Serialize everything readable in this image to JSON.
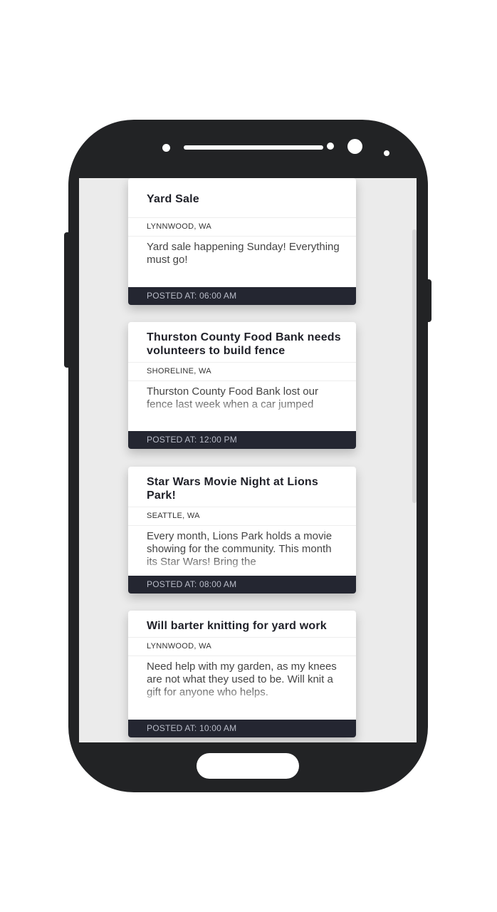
{
  "posts": [
    {
      "title": "Yard Sale",
      "location": "LYNNWOOD, WA",
      "body": "Yard sale happening Sunday! Everything must go!",
      "posted": "POSTED AT: 06:00 AM"
    },
    {
      "title": "Thurston County Food Bank needs volunteers to build fence",
      "location": "SHORELINE, WA",
      "body": "Thurston County Food Bank lost our fence last week when a car jumped",
      "posted": "POSTED AT: 12:00 PM"
    },
    {
      "title": "Star Wars Movie Night at Lions Park!",
      "location": "SEATTLE, WA",
      "body": "Every month, Lions Park holds a movie showing for the community. This month its Star Wars! Bring the",
      "posted": "POSTED AT: 08:00 AM"
    },
    {
      "title": "Will barter knitting for yard work",
      "location": "LYNNWOOD, WA",
      "body": "Need help with my garden, as my knees are not what they used to be. Will knit a gift for anyone who helps.",
      "posted": "POSTED AT: 10:00 AM"
    }
  ]
}
